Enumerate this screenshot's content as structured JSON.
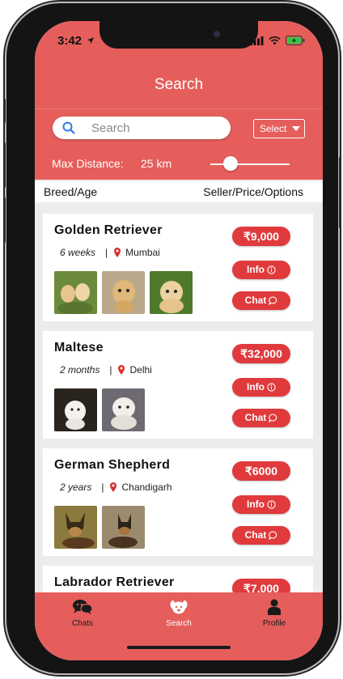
{
  "status": {
    "time": "3:42"
  },
  "header": {
    "title": "Search",
    "search_placeholder": "Search",
    "select_label": "Select",
    "max_distance_label": "Max Distance:",
    "distance_value": "25 km",
    "distance_fraction": 0.25
  },
  "columns": {
    "left": "Breed/Age",
    "right": "Seller/Price/Options"
  },
  "listings": [
    {
      "breed": "Golden Retriever",
      "age": "6 weeks",
      "location": "Mumbai",
      "price": "₹9,000",
      "info_label": "Info",
      "chat_label": "Chat"
    },
    {
      "breed": "Maltese",
      "age": "2 months",
      "location": "Delhi",
      "price": "₹32,000",
      "info_label": "Info",
      "chat_label": "Chat"
    },
    {
      "breed": "German Shepherd",
      "age": "2 years",
      "location": "Chandigarh",
      "price": "₹6000",
      "info_label": "Info",
      "chat_label": "Chat"
    },
    {
      "breed": "Labrador Retriever",
      "price": "₹7,000"
    }
  ],
  "tabbar": {
    "items": [
      {
        "label": "Chats",
        "icon": "chat-bubbles-icon",
        "active": false
      },
      {
        "label": "Search",
        "icon": "dog-face-icon",
        "active": true
      },
      {
        "label": "Profile",
        "icon": "person-icon",
        "active": false
      }
    ]
  },
  "colors": {
    "header": "#e55e5b",
    "pill": "#e03a3c",
    "active_tab": "#ffffff",
    "inactive_tab": "#1a1a1a"
  }
}
